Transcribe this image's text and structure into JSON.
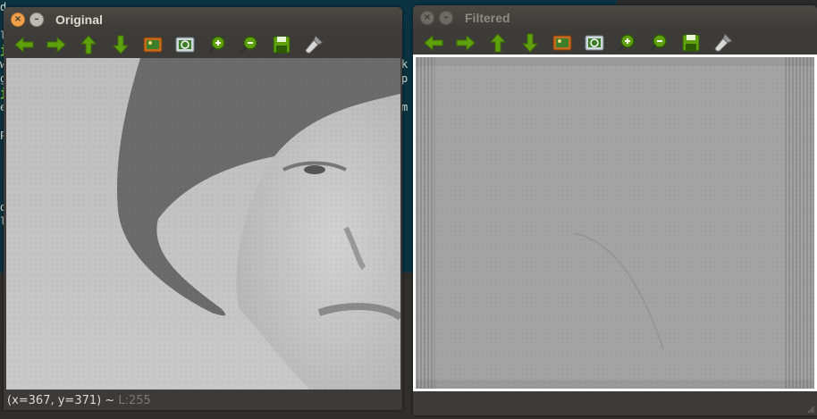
{
  "terminal": {
    "left_chars": [
      "d",
      "l",
      "j",
      "w",
      "g",
      "j",
      "e",
      "",
      "",
      "P",
      "",
      "",
      "",
      "",
      "d",
      "l"
    ],
    "mid_chars": [
      "",
      "",
      "k",
      "p",
      "",
      "m",
      "",
      "",
      "",
      "",
      "",
      "",
      "",
      "",
      "",
      ""
    ]
  },
  "windows": {
    "original": {
      "title": "Original",
      "status_coords": "(x=367, y=371) ~ ",
      "status_value": "L:255"
    },
    "filtered": {
      "title": "Filtered"
    }
  },
  "toolbar": {
    "tools": [
      "arrow-left-icon",
      "arrow-right-icon",
      "arrow-up-icon",
      "arrow-down-icon",
      "save-image-icon",
      "zoom-fit-icon",
      "zoom-in-icon",
      "zoom-out-icon",
      "save-icon",
      "properties-brush-icon"
    ]
  },
  "colors": {
    "accent_green": "#5fa10d",
    "close_button": "#f0a14b",
    "terminal_bg": "#0b3240",
    "window_bg": "#3c3b37"
  }
}
